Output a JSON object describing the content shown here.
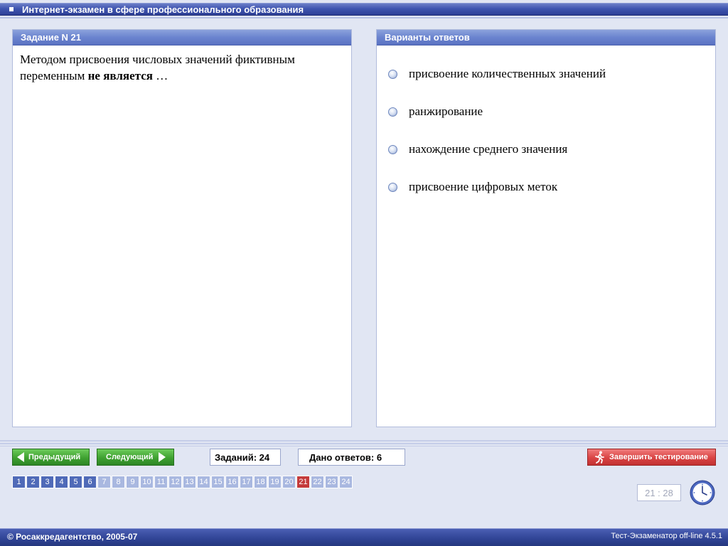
{
  "window": {
    "title": "Интернет-экзамен в сфере профессионального образования"
  },
  "question_panel": {
    "header": "Задание N 21",
    "text_part1": "Методом присвоения числовых значений фиктивным переменным ",
    "text_bold": "не является",
    "text_part2": " …"
  },
  "answers_panel": {
    "header": "Варианты ответов",
    "options": [
      "присвоение количественных значений",
      "ранжирование",
      "нахождение среднего значения",
      "присвоение цифровых меток"
    ]
  },
  "controls": {
    "prev_label": "Предыдущий",
    "next_label": "Следующий",
    "tasks_counter": "Заданий: 24",
    "answers_counter": "Дано ответов: 6",
    "finish_label": "Завершить тестирование",
    "timer": "21 : 28"
  },
  "navigation": {
    "items": [
      {
        "n": "1",
        "state": "answered"
      },
      {
        "n": "2",
        "state": "answered"
      },
      {
        "n": "3",
        "state": "answered"
      },
      {
        "n": "4",
        "state": "answered"
      },
      {
        "n": "5",
        "state": "answered"
      },
      {
        "n": "6",
        "state": "answered"
      },
      {
        "n": "7",
        "state": "unanswered"
      },
      {
        "n": "8",
        "state": "unanswered"
      },
      {
        "n": "9",
        "state": "unanswered"
      },
      {
        "n": "10",
        "state": "unanswered"
      },
      {
        "n": "11",
        "state": "unanswered"
      },
      {
        "n": "12",
        "state": "unanswered"
      },
      {
        "n": "13",
        "state": "unanswered"
      },
      {
        "n": "14",
        "state": "unanswered"
      },
      {
        "n": "15",
        "state": "unanswered"
      },
      {
        "n": "16",
        "state": "unanswered"
      },
      {
        "n": "17",
        "state": "unanswered"
      },
      {
        "n": "18",
        "state": "unanswered"
      },
      {
        "n": "19",
        "state": "unanswered"
      },
      {
        "n": "20",
        "state": "unanswered"
      },
      {
        "n": "21",
        "state": "current"
      },
      {
        "n": "22",
        "state": "unanswered"
      },
      {
        "n": "23",
        "state": "unanswered"
      },
      {
        "n": "24",
        "state": "unanswered"
      }
    ]
  },
  "footer": {
    "left": "© Росаккредагентство, 2005-07",
    "right": "Тест-Экзаменатор off-line 4.5.1"
  },
  "icons": {
    "prev": "arrow-left-icon",
    "next": "arrow-right-icon",
    "finish": "running-man-icon",
    "clock": "clock-icon",
    "radio": "radio-icon"
  },
  "colors": {
    "title_bar": "#3f55b0",
    "panel_header": "#6b84cf",
    "nav_buttons": "#3fa131",
    "finish_button": "#d94444",
    "nav_answered": "#4f6ab8",
    "nav_unanswered": "#a9b8e0",
    "nav_current": "#c43b3b"
  }
}
